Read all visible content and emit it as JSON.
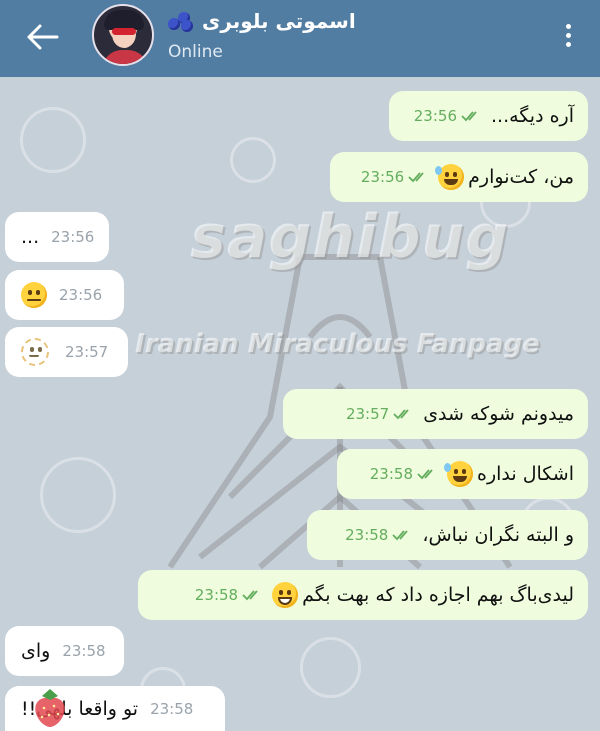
{
  "header": {
    "contact_name": "اسموتی بلوبری",
    "status": "Online",
    "back_icon": "arrow-left-icon",
    "menu_icon": "more-vertical-icon",
    "name_emoji": "blueberries-icon"
  },
  "watermark": {
    "title": "saghibug",
    "subtitle": "Iranian Miraculous Fanpage"
  },
  "colors": {
    "header_bg": "#527da3",
    "outgoing_bubble": "#effdde",
    "incoming_bubble": "#ffffff",
    "time_outgoing": "#65ad5e",
    "time_incoming": "#9aa3ab"
  },
  "messages": [
    {
      "dir": "out",
      "text": "آره دیگه...",
      "time": "23:56",
      "read": true
    },
    {
      "dir": "out",
      "text": "من، کت‌نوارم",
      "emoji": "sweat-smile",
      "time": "23:56",
      "read": true
    },
    {
      "dir": "in",
      "text": "...",
      "time": "23:56"
    },
    {
      "dir": "in",
      "text": "",
      "emoji": "neutral-face",
      "time": "23:56"
    },
    {
      "dir": "in",
      "text": "",
      "emoji": "dotted-face",
      "time": "23:57"
    },
    {
      "dir": "out",
      "text": "میدونم شوکه شدی",
      "time": "23:57",
      "read": true
    },
    {
      "dir": "out",
      "text": "اشکال نداره",
      "emoji": "sweat-smile",
      "time": "23:58",
      "read": true
    },
    {
      "dir": "out",
      "text": "و البته نگران نباش،",
      "time": "23:58",
      "read": true
    },
    {
      "dir": "out",
      "text": "لیدی‌باگ بهم اجازه داد که بهت بگم",
      "emoji": "grin",
      "time": "23:58",
      "read": true
    },
    {
      "dir": "in",
      "text": "وای",
      "time": "23:58"
    },
    {
      "dir": "in",
      "text": "تو واقعا بلهی!!",
      "time": "23:58",
      "sticker": "strawberry-icon"
    }
  ]
}
